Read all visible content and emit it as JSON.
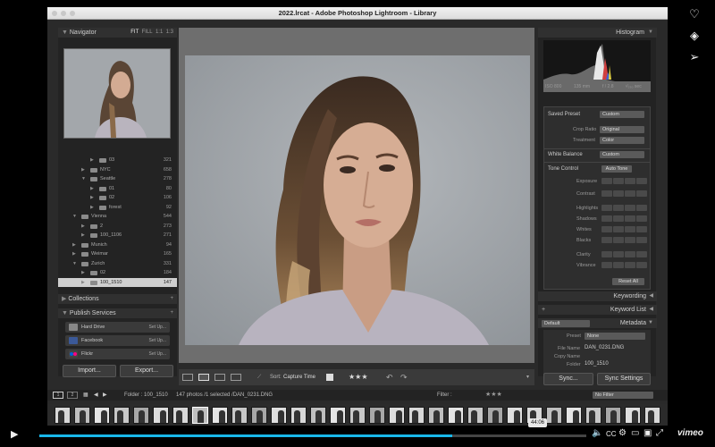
{
  "window": {
    "title": "2022.lrcat - Adobe Photoshop Lightroom - Library"
  },
  "navigator": {
    "title": "Navigator",
    "zoom": [
      "FIT",
      "FILL",
      "1:1",
      "1:3"
    ]
  },
  "folders": [
    {
      "name": "03",
      "count": "321",
      "depth": 3,
      "open": false
    },
    {
      "name": "NYC",
      "count": "658",
      "depth": 2,
      "open": false
    },
    {
      "name": "Seattle",
      "count": "278",
      "depth": 2,
      "open": true
    },
    {
      "name": "01",
      "count": "80",
      "depth": 3,
      "open": false
    },
    {
      "name": "02",
      "count": "106",
      "depth": 3,
      "open": false
    },
    {
      "name": "forest",
      "count": "92",
      "depth": 3,
      "open": false
    },
    {
      "name": "Vienna",
      "count": "544",
      "depth": 1,
      "open": true
    },
    {
      "name": "2",
      "count": "273",
      "depth": 2,
      "open": false
    },
    {
      "name": "100_1106",
      "count": "271",
      "depth": 2,
      "open": false
    },
    {
      "name": "Munich",
      "count": "94",
      "depth": 1,
      "open": false
    },
    {
      "name": "Weimar",
      "count": "165",
      "depth": 1,
      "open": false
    },
    {
      "name": "Zurich",
      "count": "331",
      "depth": 1,
      "open": true
    },
    {
      "name": "02",
      "count": "184",
      "depth": 2,
      "open": false
    },
    {
      "name": "100_1510",
      "count": "147",
      "depth": 2,
      "open": false,
      "selected": true
    }
  ],
  "collections": {
    "title": "Collections"
  },
  "publish": {
    "title": "Publish Services",
    "items": [
      {
        "name": "Hard Drive",
        "action": "Set Up..."
      },
      {
        "name": "Facebook",
        "action": "Set Up..."
      },
      {
        "name": "Flickr",
        "action": "Set Up..."
      }
    ]
  },
  "left_buttons": {
    "import": "Import...",
    "export": "Export..."
  },
  "toolbar": {
    "sort_label": "Sort:",
    "sort_value": "Capture Time",
    "rating": "★★★"
  },
  "histogram": {
    "title": "Histogram",
    "iso": "ISO 800",
    "focal": "135 mm",
    "aperture": "f / 2.8",
    "shutter": "¹⁄₂₅₀ sec"
  },
  "quick_develop": {
    "saved_preset_label": "Saved Preset",
    "saved_preset_value": "Custom",
    "crop_label": "Crop Ratio",
    "crop_value": "Original",
    "treatment_label": "Treatment",
    "treatment_value": "Color",
    "wb_label": "White Balance",
    "wb_value": "Custom",
    "tone_label": "Tone Control",
    "auto_tone": "Auto Tone",
    "rows": [
      "Exposure",
      "Contrast",
      "Highlights",
      "Shadows",
      "Whites",
      "Blacks",
      "Clarity",
      "Vibrance"
    ],
    "reset": "Reset All"
  },
  "keywording": "Keywording",
  "keyword_list": "Keyword List",
  "metadata": {
    "title": "Metadata",
    "preset_dropdown": "Default",
    "preset_label": "Preset",
    "preset_value": "None",
    "file_name_label": "File Name",
    "file_name": "DAN_0231.DNG",
    "copy_name_label": "Copy Name",
    "folder_label": "Folder",
    "folder": "100_1510"
  },
  "right_buttons": {
    "sync": "Sync...",
    "sync_settings": "Sync Settings"
  },
  "filmstrip_bar": {
    "page1": "1",
    "page2": "2",
    "folder_text": "Folder : 100_1510",
    "count_text": "147 photos /1 selected /DAN_0231.DNG",
    "filter_label": "Filter :",
    "filter_value": "No Filter"
  },
  "player": {
    "time": "44:06",
    "progress": 0.755,
    "brand": "vimeo"
  },
  "colors": {
    "accent": "#19b7ea",
    "panel": "#232323",
    "selected": "#cfcfcf"
  }
}
